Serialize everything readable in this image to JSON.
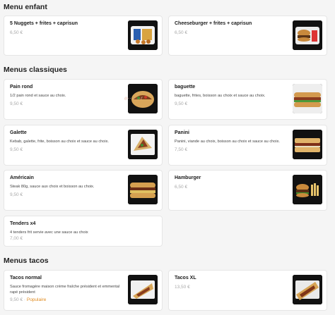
{
  "sections": [
    {
      "title": "Menu enfant",
      "items": [
        {
          "name": "5 Nuggets + frites + caprisun",
          "desc": "",
          "price": "6,50 €",
          "icon": "nuggets-meal-photo"
        },
        {
          "name": "Cheeseburger + frites + caprisun",
          "desc": "",
          "price": "6,50 €",
          "icon": "cheeseburger-meal-photo"
        }
      ]
    },
    {
      "title": "Menus classiques",
      "items": [
        {
          "name": "Pain rond",
          "desc": "1/2 pain rond et sauce au choix.",
          "price": "9,50 €",
          "icon": "kebab-bun-photo"
        },
        {
          "name": "baguette",
          "desc": "baguette, frites, boisson au choix et sauce au choix.",
          "price": "9,50 €",
          "icon": "baguette-sandwich-photo"
        },
        {
          "name": "Galette",
          "desc": "Kebab, galette, frite, boisson au choix et sauce au choix.",
          "price": "9,50 €",
          "icon": "galette-wrap-photo"
        },
        {
          "name": "Panini",
          "desc": "Panini, viande au choix, boisson au choix et sauce au choix.",
          "price": "7,50 €",
          "icon": "panini-photo"
        },
        {
          "name": "Américain",
          "desc": "Steak 80g, sauce aux choix et boisson au choix.",
          "price": "9,50 €",
          "icon": "americain-sandwich-photo"
        },
        {
          "name": "Hamburger",
          "desc": "",
          "price": "6,50 €",
          "icon": "hamburger-photo"
        },
        {
          "name": "Tenders x4",
          "desc": "4 tenders frit servie avec une sauce au choix",
          "price": "7,00 €",
          "icon": ""
        }
      ]
    },
    {
      "title": "Menus tacos",
      "items": [
        {
          "name": "Tacos normal",
          "desc": "Sauce fromagère maison crème fraîche président et emmental rapé président",
          "price": "9,50 €",
          "badge": "Populaire",
          "icon": "tacos-normal-photo"
        },
        {
          "name": "Tacos XL",
          "desc": "",
          "price": "13,50 €",
          "icon": "tacos-xl-photo"
        }
      ]
    }
  ],
  "price_separator": " · ",
  "watermark": "e·······r",
  "colors": {
    "background": "#f5f5f5",
    "card": "#ffffff",
    "price": "#a9a9a9",
    "popular": "#e08a1e"
  }
}
